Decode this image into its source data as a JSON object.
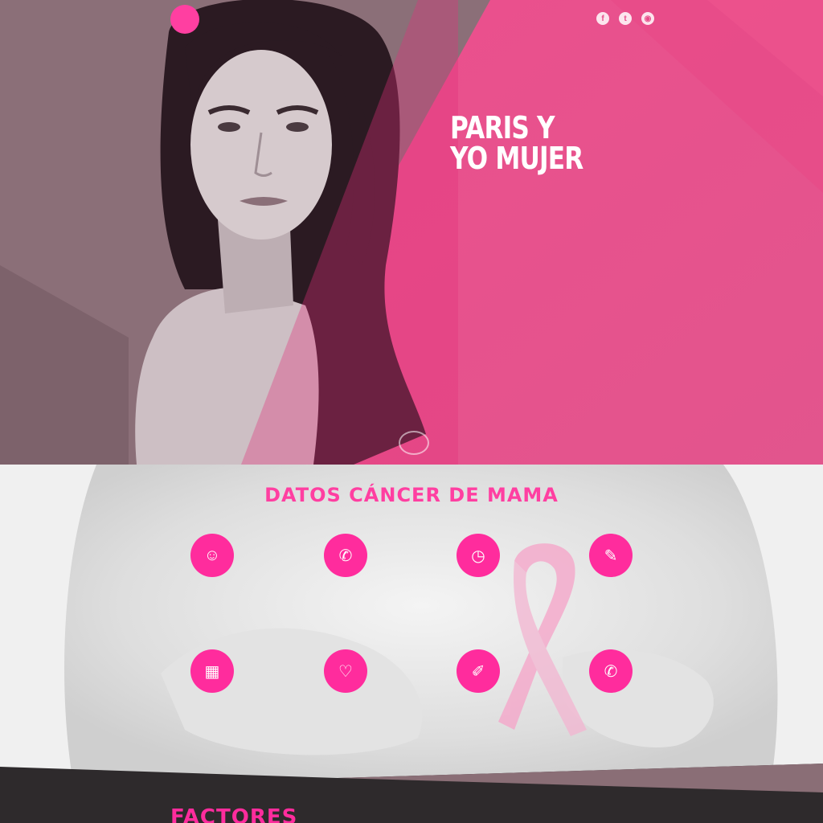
{
  "colors": {
    "brand_pink": "#ff3fa1",
    "hero_pink": "#e84d8a",
    "muted_mauve": "#8a6e76",
    "dark_band": "#2e2a2c"
  },
  "nav": {
    "logo_icon": "pink-circle-logo",
    "logo_script": "",
    "items": [
      {
        "label": ""
      },
      {
        "label": ""
      },
      {
        "label": ""
      },
      {
        "label": ""
      },
      {
        "label": ""
      }
    ],
    "social": [
      {
        "icon": "facebook-icon",
        "glyph": "f"
      },
      {
        "icon": "twitter-icon",
        "glyph": "t"
      },
      {
        "icon": "instagram-icon",
        "glyph": "◉"
      }
    ]
  },
  "hero": {
    "title_line1": "PARIS Y",
    "title_line2": "YO MUJER",
    "paragraph1": "",
    "paragraph2": "",
    "signature": ""
  },
  "facts": {
    "title": "DATOS CÁNCER DE MAMA",
    "items": [
      {
        "icon": "chat-icon",
        "glyph": "☺",
        "title": "",
        "text": ""
      },
      {
        "icon": "phone-icon",
        "glyph": "✆",
        "title": "",
        "text": ""
      },
      {
        "icon": "clock-icon",
        "glyph": "◷",
        "title": "",
        "text": ""
      },
      {
        "icon": "pen-icon",
        "glyph": "✎",
        "title": "",
        "text": ""
      },
      {
        "icon": "chart-icon",
        "glyph": "▦",
        "title": "",
        "text": ""
      },
      {
        "icon": "heart-icon",
        "glyph": "♡",
        "title": "",
        "text": ""
      },
      {
        "icon": "pencil-icon",
        "glyph": "✐",
        "title": "",
        "text": ""
      },
      {
        "icon": "phone-icon",
        "glyph": "✆",
        "title": "",
        "text": ""
      }
    ]
  },
  "bottom": {
    "title": "FACTORES"
  }
}
